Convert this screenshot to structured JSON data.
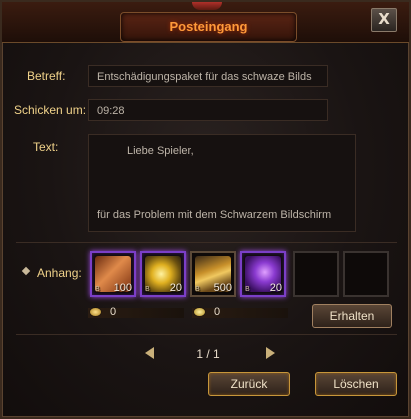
{
  "window": {
    "title": "Posteingang",
    "close_label": "X"
  },
  "mail": {
    "subject_label": "Betreff:",
    "subject_value": "Entschädigungspaket für das schwaze Bilds",
    "sent_label": "Schicken um:",
    "sent_value": "09:28",
    "text_label": "Text:",
    "body_line1": "Liebe Spieler,",
    "body_line2": "für das Problem mit dem Schwarzem Bildschirm"
  },
  "attachments": {
    "label": "Anhang:",
    "items": [
      {
        "icon": "scroll-bundle-icon",
        "quantity": "100",
        "bound": "B"
      },
      {
        "icon": "gold-token-icon",
        "quantity": "20",
        "bound": "B"
      },
      {
        "icon": "treasure-pile-icon",
        "quantity": "500",
        "bound": "B"
      },
      {
        "icon": "purple-gem-icon",
        "quantity": "20",
        "bound": "B"
      },
      {
        "icon": "empty-slot",
        "quantity": ""
      },
      {
        "icon": "empty-slot",
        "quantity": ""
      }
    ],
    "gold_value": "0",
    "bound_gold_value": "0",
    "claim_label": "Erhalten"
  },
  "pager": {
    "text": "1 / 1"
  },
  "footer": {
    "back_label": "Zurück",
    "delete_label": "Löschen"
  },
  "colors": {
    "title": "#ff9a3a",
    "label": "#f0d28a",
    "rare_border": "#7b3fc7"
  }
}
